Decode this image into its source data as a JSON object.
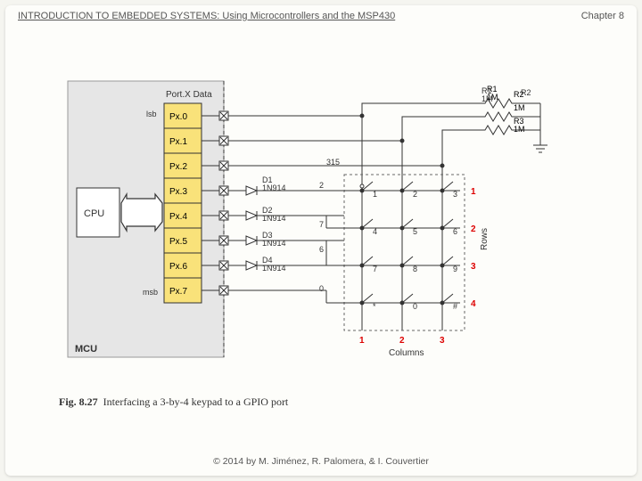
{
  "header": {
    "title": "INTRODUCTION TO EMBEDDED SYSTEMS: Using Microcontrollers and the MSP430",
    "chapter": "Chapter 8"
  },
  "footer": {
    "copyright": "© 2014 by M. Jiménez, R. Palomera, & I. Couvertier"
  },
  "caption": {
    "label": "Fig. 8.27",
    "text": "Interfacing a 3-by-4 keypad to a GPIO port"
  },
  "diagram": {
    "mcu_label": "MCU",
    "cpu_label": "CPU",
    "port_header": "Port.X Data",
    "lsb": "lsb",
    "msb": "msb",
    "ports": [
      "Px.0",
      "Px.1",
      "Px.2",
      "Px.3",
      "Px.4",
      "Px.5",
      "Px.6",
      "Px.7"
    ],
    "diodes": [
      {
        "name": "D1",
        "part": "1N914"
      },
      {
        "name": "D2",
        "part": "1N914"
      },
      {
        "name": "D3",
        "part": "1N914"
      },
      {
        "name": "D4",
        "part": "1N914"
      }
    ],
    "resistors": [
      {
        "name": "R1",
        "value": "1M"
      },
      {
        "name": "R2",
        "value": "1M"
      },
      {
        "name": "R3",
        "value": "1M"
      }
    ],
    "keypad": {
      "keys": [
        [
          "1",
          "2",
          "3"
        ],
        [
          "4",
          "5",
          "6"
        ],
        [
          "7",
          "8",
          "9"
        ],
        [
          "*",
          "0",
          "#"
        ]
      ],
      "row_labels": [
        "1",
        "2",
        "3",
        "4"
      ],
      "col_labels": [
        "1",
        "2",
        "3"
      ],
      "rows_text": "Rows",
      "cols_text": "Columns",
      "wire_num_top": "315",
      "row_taps": [
        "2",
        "7",
        "6",
        "0"
      ]
    }
  }
}
